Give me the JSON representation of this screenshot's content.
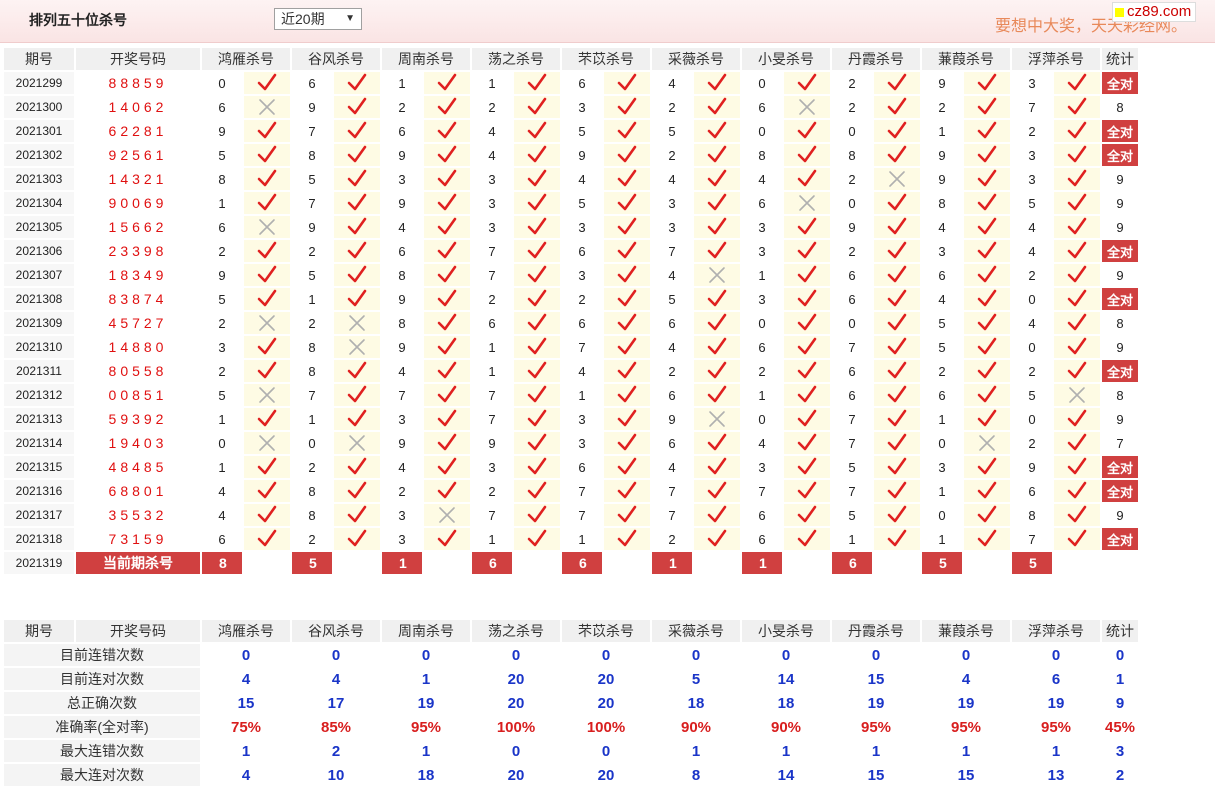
{
  "header": {
    "title": "排列五十位杀号",
    "period_select": "近20期",
    "slogan": "要想中大奖，天天彩经网。",
    "brand": "cz89.com"
  },
  "columns": {
    "period": "期号",
    "draw": "开奖号码",
    "experts": [
      "鸿雁杀号",
      "谷风杀号",
      "周南杀号",
      "荡之杀号",
      "芣苡杀号",
      "采薇杀号",
      "小旻杀号",
      "丹霞杀号",
      "蒹葭杀号",
      "浮萍杀号"
    ],
    "stat": "统计"
  },
  "rows": [
    {
      "period": "2021299",
      "draw": "88859",
      "nums": [
        0,
        6,
        1,
        1,
        6,
        4,
        0,
        2,
        9,
        3
      ],
      "hits": [
        1,
        1,
        1,
        1,
        1,
        1,
        1,
        1,
        1,
        1
      ],
      "stat": "全对"
    },
    {
      "period": "2021300",
      "draw": "14062",
      "nums": [
        6,
        9,
        2,
        2,
        3,
        2,
        6,
        2,
        2,
        7
      ],
      "hits": [
        0,
        1,
        1,
        1,
        1,
        1,
        0,
        1,
        1,
        1
      ],
      "stat": "8"
    },
    {
      "period": "2021301",
      "draw": "62281",
      "nums": [
        9,
        7,
        6,
        4,
        5,
        5,
        0,
        0,
        1,
        2
      ],
      "hits": [
        1,
        1,
        1,
        1,
        1,
        1,
        1,
        1,
        1,
        1
      ],
      "stat": "全对"
    },
    {
      "period": "2021302",
      "draw": "92561",
      "nums": [
        5,
        8,
        9,
        4,
        9,
        2,
        8,
        8,
        9,
        3
      ],
      "hits": [
        1,
        1,
        1,
        1,
        1,
        1,
        1,
        1,
        1,
        1
      ],
      "stat": "全对"
    },
    {
      "period": "2021303",
      "draw": "14321",
      "nums": [
        8,
        5,
        3,
        3,
        4,
        4,
        4,
        2,
        9,
        3
      ],
      "hits": [
        1,
        1,
        1,
        1,
        1,
        1,
        1,
        0,
        1,
        1
      ],
      "stat": "9"
    },
    {
      "period": "2021304",
      "draw": "90069",
      "nums": [
        1,
        7,
        9,
        3,
        5,
        3,
        6,
        0,
        8,
        5
      ],
      "hits": [
        1,
        1,
        1,
        1,
        1,
        1,
        0,
        1,
        1,
        1
      ],
      "stat": "9"
    },
    {
      "period": "2021305",
      "draw": "15662",
      "nums": [
        6,
        9,
        4,
        3,
        3,
        3,
        3,
        9,
        4,
        4
      ],
      "hits": [
        0,
        1,
        1,
        1,
        1,
        1,
        1,
        1,
        1,
        1
      ],
      "stat": "9"
    },
    {
      "period": "2021306",
      "draw": "23398",
      "nums": [
        2,
        2,
        6,
        7,
        6,
        7,
        3,
        2,
        3,
        4
      ],
      "hits": [
        1,
        1,
        1,
        1,
        1,
        1,
        1,
        1,
        1,
        1
      ],
      "stat": "全对"
    },
    {
      "period": "2021307",
      "draw": "18349",
      "nums": [
        9,
        5,
        8,
        7,
        3,
        4,
        1,
        6,
        6,
        2
      ],
      "hits": [
        1,
        1,
        1,
        1,
        1,
        0,
        1,
        1,
        1,
        1
      ],
      "stat": "9"
    },
    {
      "period": "2021308",
      "draw": "83874",
      "nums": [
        5,
        1,
        9,
        2,
        2,
        5,
        3,
        6,
        4,
        0
      ],
      "hits": [
        1,
        1,
        1,
        1,
        1,
        1,
        1,
        1,
        1,
        1
      ],
      "stat": "全对"
    },
    {
      "period": "2021309",
      "draw": "45727",
      "nums": [
        2,
        2,
        8,
        6,
        6,
        6,
        0,
        0,
        5,
        4
      ],
      "hits": [
        0,
        0,
        1,
        1,
        1,
        1,
        1,
        1,
        1,
        1
      ],
      "stat": "8"
    },
    {
      "period": "2021310",
      "draw": "14880",
      "nums": [
        3,
        8,
        9,
        1,
        7,
        4,
        6,
        7,
        5,
        0
      ],
      "hits": [
        1,
        0,
        1,
        1,
        1,
        1,
        1,
        1,
        1,
        1
      ],
      "stat": "9"
    },
    {
      "period": "2021311",
      "draw": "80558",
      "nums": [
        2,
        8,
        4,
        1,
        4,
        2,
        2,
        6,
        2,
        2
      ],
      "hits": [
        1,
        1,
        1,
        1,
        1,
        1,
        1,
        1,
        1,
        1
      ],
      "stat": "全对"
    },
    {
      "period": "2021312",
      "draw": "00851",
      "nums": [
        5,
        7,
        7,
        7,
        1,
        6,
        1,
        6,
        6,
        5
      ],
      "hits": [
        0,
        1,
        1,
        1,
        1,
        1,
        1,
        1,
        1,
        0
      ],
      "stat": "8"
    },
    {
      "period": "2021313",
      "draw": "59392",
      "nums": [
        1,
        1,
        3,
        7,
        3,
        9,
        0,
        7,
        1,
        0
      ],
      "hits": [
        1,
        1,
        1,
        1,
        1,
        0,
        1,
        1,
        1,
        1
      ],
      "stat": "9"
    },
    {
      "period": "2021314",
      "draw": "19403",
      "nums": [
        0,
        0,
        9,
        9,
        3,
        6,
        4,
        7,
        0,
        2
      ],
      "hits": [
        0,
        0,
        1,
        1,
        1,
        1,
        1,
        1,
        0,
        1
      ],
      "stat": "7"
    },
    {
      "period": "2021315",
      "draw": "48485",
      "nums": [
        1,
        2,
        4,
        3,
        6,
        4,
        3,
        5,
        3,
        9
      ],
      "hits": [
        1,
        1,
        1,
        1,
        1,
        1,
        1,
        1,
        1,
        1
      ],
      "stat": "全对"
    },
    {
      "period": "2021316",
      "draw": "68801",
      "nums": [
        4,
        8,
        2,
        2,
        7,
        7,
        7,
        7,
        1,
        6
      ],
      "hits": [
        1,
        1,
        1,
        1,
        1,
        1,
        1,
        1,
        1,
        1
      ],
      "stat": "全对"
    },
    {
      "period": "2021317",
      "draw": "35532",
      "nums": [
        4,
        8,
        3,
        7,
        7,
        7,
        6,
        5,
        0,
        8
      ],
      "hits": [
        1,
        1,
        0,
        1,
        1,
        1,
        1,
        1,
        1,
        1
      ],
      "stat": "9"
    },
    {
      "period": "2021318",
      "draw": "73159",
      "nums": [
        6,
        2,
        3,
        1,
        1,
        2,
        6,
        1,
        1,
        7
      ],
      "hits": [
        1,
        1,
        1,
        1,
        1,
        1,
        1,
        1,
        1,
        1
      ],
      "stat": "全对"
    }
  ],
  "current": {
    "period": "2021319",
    "label": "当前期杀号",
    "nums": [
      "8",
      "5",
      "1",
      "6",
      "6",
      "1",
      "1",
      "6",
      "5",
      "5"
    ]
  },
  "stats": [
    {
      "label": "目前连错次数",
      "values": [
        "0",
        "0",
        "0",
        "0",
        "0",
        "0",
        "0",
        "0",
        "0",
        "0",
        "0"
      ],
      "red": false
    },
    {
      "label": "目前连对次数",
      "values": [
        "4",
        "4",
        "1",
        "20",
        "20",
        "5",
        "14",
        "15",
        "4",
        "6",
        "1"
      ],
      "red": false
    },
    {
      "label": "总正确次数",
      "values": [
        "15",
        "17",
        "19",
        "20",
        "20",
        "18",
        "18",
        "19",
        "19",
        "19",
        "9"
      ],
      "red": false
    },
    {
      "label": "准确率(全对率)",
      "values": [
        "75%",
        "85%",
        "95%",
        "100%",
        "100%",
        "90%",
        "90%",
        "95%",
        "95%",
        "95%",
        "45%"
      ],
      "red": true
    },
    {
      "label": "最大连错次数",
      "values": [
        "1",
        "2",
        "1",
        "0",
        "0",
        "1",
        "1",
        "1",
        "1",
        "1",
        "3"
      ],
      "red": false
    },
    {
      "label": "最大连对次数",
      "values": [
        "4",
        "10",
        "18",
        "20",
        "20",
        "8",
        "14",
        "15",
        "15",
        "13",
        "2"
      ],
      "red": false
    }
  ],
  "colors": {
    "hit": "#e02020",
    "miss": "#b0b0b0",
    "full_badge": "#d04040",
    "stat_value": "#1a35c8",
    "stat_rate": "#d81e1e"
  },
  "icons": {
    "hit": "check-icon",
    "miss": "cross-icon"
  }
}
